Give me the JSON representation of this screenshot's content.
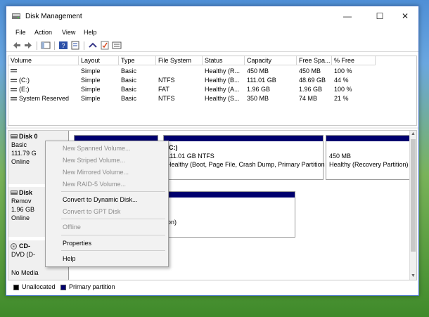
{
  "window": {
    "title": "Disk Management"
  },
  "window_controls": {
    "minimize": "—",
    "maximize": "☐",
    "close": "✕"
  },
  "menu": [
    "File",
    "Action",
    "View",
    "Help"
  ],
  "toolbar_icons": [
    "back-icon",
    "forward-icon",
    "console-tree-icon",
    "help-icon",
    "properties-icon",
    "connect-icon",
    "check-icon",
    "settings-icon"
  ],
  "volume_table": {
    "columns": [
      "Volume",
      "Layout",
      "Type",
      "File System",
      "Status",
      "Capacity",
      "Free Spa...",
      "% Free"
    ],
    "rows": [
      [
        "",
        "Simple",
        "Basic",
        "",
        "Healthy (R...",
        "450 MB",
        "450 MB",
        "100 %"
      ],
      [
        "(C:)",
        "Simple",
        "Basic",
        "NTFS",
        "Healthy (B...",
        "111.01 GB",
        "48.69 GB",
        "44 %"
      ],
      [
        "(E:)",
        "Simple",
        "Basic",
        "FAT",
        "Healthy (A...",
        "1.96 GB",
        "1.96 GB",
        "100 %"
      ],
      [
        "System Reserved",
        "Simple",
        "Basic",
        "NTFS",
        "Healthy (S...",
        "350 MB",
        "74 MB",
        "21 %"
      ]
    ]
  },
  "disks": [
    {
      "name": "Disk 0",
      "lines": [
        "Basic",
        "111.79 G",
        "Online"
      ]
    },
    {
      "name": "Disk",
      "lines": [
        "Remov",
        "1.96 GB",
        "Online"
      ]
    },
    {
      "name": "CD-",
      "lines": [
        "DVD (D-",
        "",
        "No Media"
      ]
    }
  ],
  "partitions": {
    "c_drive": {
      "title": "(C:)",
      "size": "111.01 GB NTFS",
      "status": "Healthy (Boot, Page File, Crash Dump, Primary Partition"
    },
    "recovery": {
      "size": "450 MB",
      "status": "Healthy (Recovery Partition)"
    },
    "removable": {
      "status": "on)"
    }
  },
  "legend": {
    "unallocated": "Unallocated",
    "primary": "Primary partition"
  },
  "legend_colors": {
    "unallocated": "#000000",
    "primary": "#00006e"
  },
  "context_menu": [
    {
      "label": "New Spanned Volume...",
      "enabled": false
    },
    {
      "label": "New Striped Volume...",
      "enabled": false
    },
    {
      "label": "New Mirrored Volume...",
      "enabled": false
    },
    {
      "label": "New RAID-5 Volume...",
      "enabled": false
    },
    {
      "label": "Convert to Dynamic Disk...",
      "enabled": true
    },
    {
      "label": "Convert to GPT Disk",
      "enabled": false
    },
    {
      "label": "Offline",
      "enabled": false
    },
    {
      "label": "Properties",
      "enabled": true
    },
    {
      "label": "Help",
      "enabled": true
    }
  ]
}
